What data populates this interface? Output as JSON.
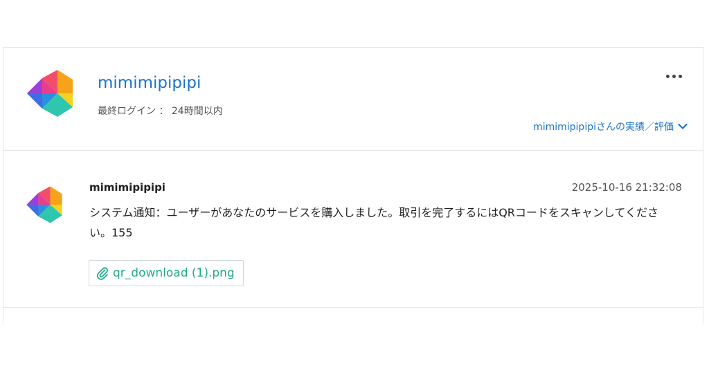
{
  "profile": {
    "username": "mimimipipipi",
    "last_login_label": "最終ログイン ： 24時間以内",
    "more_icon": "more-horizontal-icon",
    "rating_link": "mimimipipipiさんの実績／評価",
    "rating_icon": "chevron-down-icon"
  },
  "message": {
    "sender": "mimimipipipi",
    "timestamp": "2025-10-16 21:32:08",
    "body": "システム通知：ユーザーがあなたのサービスを購入しました。取引を完了するにはQRコードをスキャンしてください。155",
    "attachment": {
      "icon": "paperclip-icon",
      "filename": "qr_download (1).png"
    }
  },
  "colors": {
    "link": "#1a73c9",
    "attachment": "#1faa8a"
  }
}
